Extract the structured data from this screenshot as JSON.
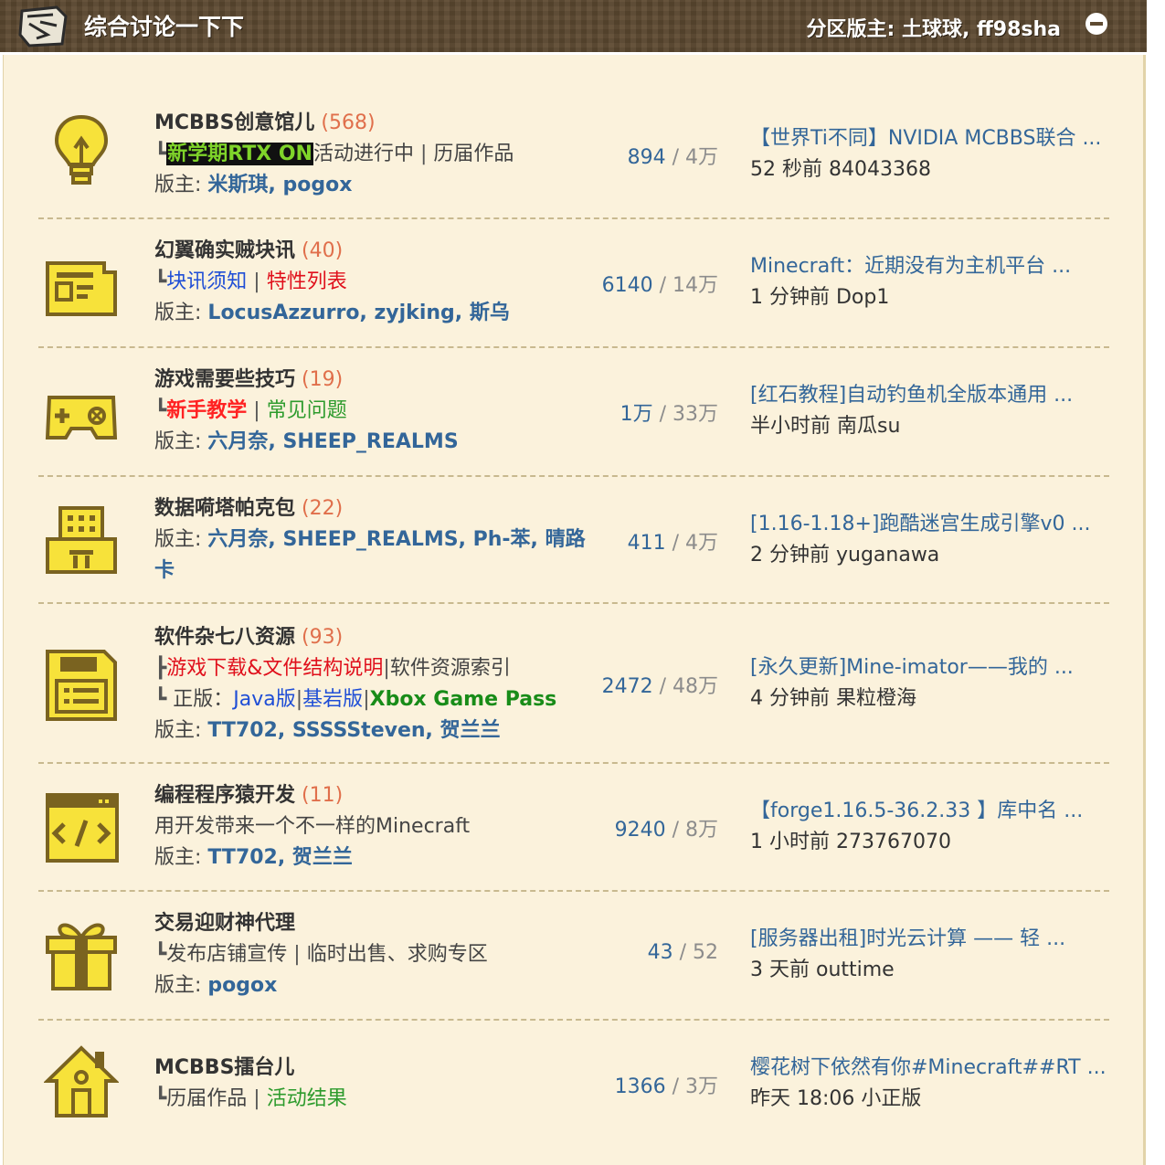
{
  "header": {
    "title": "综合讨论一下下",
    "moderators": "分区版主: 土球球, ff98sha"
  },
  "forums": [
    {
      "name": "MCBBS创意馆儿",
      "count": "(568)",
      "sub_highlight": "新学期RTX ON",
      "sub_rest": "活动进行中",
      "sub_sep": "|",
      "sub_link": "历届作品",
      "mods_label": "版主:",
      "mods": [
        "米斯琪",
        "pogox"
      ],
      "threads": "894",
      "posts": "4万",
      "last_title": "【世界Ti不同】NVIDIA MCBBS联合 ...",
      "last_meta": "52 秒前 84043368"
    },
    {
      "name": "幻翼确实贼块讯",
      "count": "(40)",
      "sub_a": "块讯须知",
      "sub_sep": "|",
      "sub_b": "特性列表",
      "mods_label": "版主:",
      "mods": [
        "LocusAzzurro",
        "zyjking",
        "斯乌"
      ],
      "threads": "6140",
      "posts": "14万",
      "last_title": "Minecraft：近期没有为主机平台 ...",
      "last_meta": "1 分钟前 Dop1"
    },
    {
      "name": "游戏需要些技巧",
      "count": "(19)",
      "sub_a": "新手教学",
      "sub_sep": "|",
      "sub_b": "常见问题",
      "mods_label": "版主:",
      "mods": [
        "六月奈",
        "SHEEP_REALMS"
      ],
      "threads": "1万",
      "posts": "33万",
      "last_title": "[红石教程]自动钓鱼机全版本通用 ...",
      "last_meta": "半小时前 南瓜su"
    },
    {
      "name": "数据嗬塔帕克包",
      "count": "(22)",
      "mods_label": "版主:",
      "mods_line1": "六月奈, SHEEP_REALMS, Ph-苯, 晴路",
      "mods_line2": "卡",
      "threads": "411",
      "posts": "4万",
      "last_title": "[1.16-1.18+]跑酷迷宫生成引擎v0 ...",
      "last_meta": "2 分钟前 yuganawa"
    },
    {
      "name": "软件杂七八资源",
      "count": "(93)",
      "sub_a": "游戏下载&文件结构说明",
      "sub_sep": "|",
      "sub_b": "软件资源索引",
      "sub2_label": "正版：",
      "sub2_a": "Java版",
      "sub2_b": "基岩版",
      "sub2_c": "Xbox Game Pass",
      "mods_label": "版主:",
      "mods": [
        "TT702",
        "SSSSSteven",
        "贺兰兰"
      ],
      "threads": "2472",
      "posts": "48万",
      "last_title": "[永久更新]Mine-imator——我的 ...",
      "last_meta": "4 分钟前 果粒橙海"
    },
    {
      "name": "编程程序猿开发",
      "count": "(11)",
      "desc": "用开发带来一个不一样的Minecraft",
      "mods_label": "版主:",
      "mods": [
        "TT702",
        "贺兰兰"
      ],
      "threads": "9240",
      "posts": "8万",
      "last_title": "【forge1.16.5-36.2.33 】库中名 ...",
      "last_meta": "1 小时前 273767070"
    },
    {
      "name": "交易迎财神代理",
      "sub_a": "发布店铺宣传",
      "sub_sep": "|",
      "sub_b": "临时出售、求购专区",
      "mods_label": "版主:",
      "mods": [
        "pogox"
      ],
      "threads": "43",
      "posts": "52",
      "last_title": "[服务器出租]时光云计算 —— 轻 ...",
      "last_meta": "3 天前 outtime"
    },
    {
      "name": "MCBBS擂台儿",
      "sub_a": "历届作品",
      "sub_sep": "|",
      "sub_b": "活动结果",
      "threads": "1366",
      "posts": "3万",
      "last_title": "樱花树下依然有你#Minecraft##RT ...",
      "last_meta": "昨天 18:06 小正版"
    }
  ],
  "tree_glyph": "┗",
  "tree_mid": "┣",
  "stat_sep": "/",
  "mod_sep": ", ",
  "colors": {
    "header_bg": "#5e4a32",
    "panel_bg": "#fbf2dc",
    "link_blue": "#336699",
    "count_orange": "#e06f4b",
    "icon_yellow": "#f7e23a",
    "icon_outline": "#7a6320"
  }
}
